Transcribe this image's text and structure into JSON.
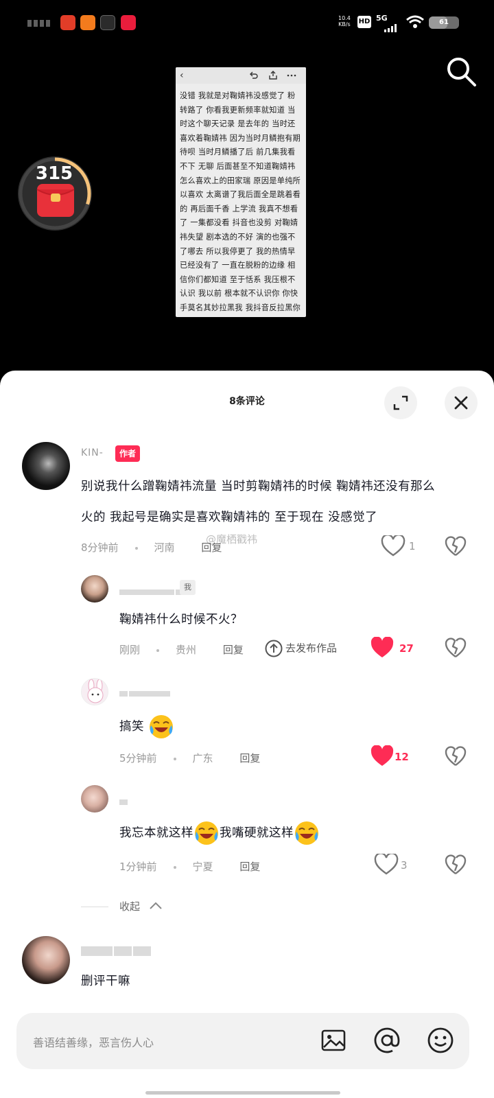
{
  "status_bar": {
    "network_speed_value": "10.4",
    "network_speed_unit": "KB/s",
    "hd_label": "HD",
    "network_type": "5G",
    "battery_level": "61",
    "apps": [
      {
        "name": "app-icon-1",
        "color": "#e23d28"
      },
      {
        "name": "app-icon-2",
        "color": "#f37b1d"
      },
      {
        "name": "app-icon-3",
        "color": "#2b2b2b"
      },
      {
        "name": "app-icon-4",
        "color": "#ea1d3c"
      }
    ]
  },
  "red_packet": {
    "count": "315",
    "progress": 0.3
  },
  "document": {
    "toolbar_back": "‹",
    "text": "没错 我就是对鞠婧祎没感觉了 粉转路了 你看我更新频率就知道 当时这个聊天记录 是去年的 当时还喜欢着鞠婧祎 因为当时月鳞抱有期待呗 当时月鳞播了后 前几集我看不下 无聊 后面甚至不知道鞠婧祎怎么喜欢上的田家瑞 原因是单纯所以喜欢 太离谱了我后面全是跳着看的 再后面千香 上学流 我真不想看了 一集都没看 抖音也没剪 对鞠婧祎失望 剧本选的不好 演的也强不了哪去 所以我停更了 我的热情早已经没有了 一直在脱粉的边缘 相信你们都知道 至于恬系 我压根不认识 我以前 根本就不认识你 你快手莫名其妙拉黑我 我抖音反拉黑你 咋了 有什么问题 现在挂我 晚了 我早脱粉了 鞠婧祎粉丝低龄粉多 全是对骂 把内娱惹个遍 我"
  },
  "sheet": {
    "title": "8条评论",
    "watermark": "@魔栖戳祎",
    "collapse_label": "收起"
  },
  "comments": [
    {
      "username": "KIN-",
      "tag": "作者",
      "line1": "别说我什么蹭鞠婧祎流量  当时剪鞠婧祎的时候  鞠婧祎还没有那么",
      "line2": "火的  我起号是确实是喜欢鞠婧祎的  至于现在  没感觉了",
      "time": "8分钟前",
      "location": "河南",
      "reply": "回复",
      "likes": "1",
      "liked": false
    },
    {
      "tag": "我",
      "text": "鞠婧祎什么时候不火？",
      "time": "刚刚",
      "location": "贵州",
      "reply": "回复",
      "goto": "去发布作品",
      "likes": "27",
      "liked": true
    },
    {
      "text": "搞笑",
      "emoji": "cry-laugh-emoji",
      "time": "5分钟前",
      "location": "广东",
      "reply": "回复",
      "likes": "12",
      "liked": true
    },
    {
      "text_a": "我忘本就这样",
      "text_b": "我嘴硬就这样",
      "emoji": "cry-laugh-emoji",
      "time": "1分钟前",
      "location": "宁夏",
      "reply": "回复",
      "likes": "3",
      "liked": false
    },
    {
      "text": "删评干嘛"
    }
  ],
  "input": {
    "placeholder": "善语结善缘，恶言伤人心"
  },
  "colors": {
    "accent": "#fe2c55",
    "background": "#000000",
    "sheet": "#ffffff"
  }
}
